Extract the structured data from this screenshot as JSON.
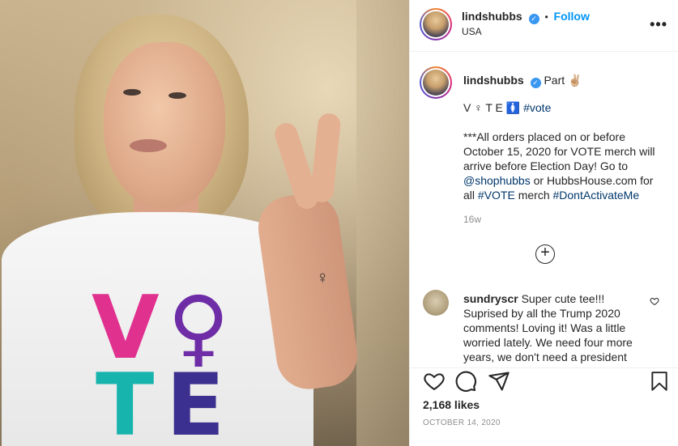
{
  "photo": {
    "shirt_letters": [
      "V",
      "♀",
      "T",
      "E"
    ],
    "colors": {
      "v": "#e0318f",
      "o": "#6e2ca6",
      "t": "#17b3ad",
      "e": "#3b2f8f"
    }
  },
  "header": {
    "username": "lindshubbs",
    "separator": "•",
    "follow_label": "Follow",
    "location": "USA",
    "more_icon": "more-options-icon"
  },
  "caption": {
    "username": "lindshubbs",
    "part_text": "Part",
    "part_emoji": "✌🏼",
    "line1_prefix": "V ♀ T E",
    "line1_emoji": "🚺",
    "line1_hashtag": "#vote",
    "line2": "***All orders placed on or before",
    "line3": "October 15, 2020 for VOTE merch will",
    "line4": "arrive before Election Day! Go to",
    "line5_link": "@shophubbs",
    "line5_text": " or HubbsHouse.com for",
    "line6_prefix": "all ",
    "line6_hashtag1": "#VOTE",
    "line6_mid": " merch ",
    "line6_hashtag2": "#DontActivateMe",
    "time_ago": "16w"
  },
  "load_more": {
    "label": "+"
  },
  "comments": [
    {
      "username": "sundryscr",
      "lines": [
        "Super cute tee!!!",
        "Suprised by all the Trump 2020",
        "comments! Loving it! Was a little",
        "worried lately. We need four more",
        "years, we don't need a president"
      ]
    }
  ],
  "actions": {
    "likes": "2,168 likes",
    "date": "OCTOBER 14, 2020"
  },
  "accent": {
    "blue": "#0095f6",
    "link": "#00376b",
    "muted": "#8e8e8e"
  }
}
